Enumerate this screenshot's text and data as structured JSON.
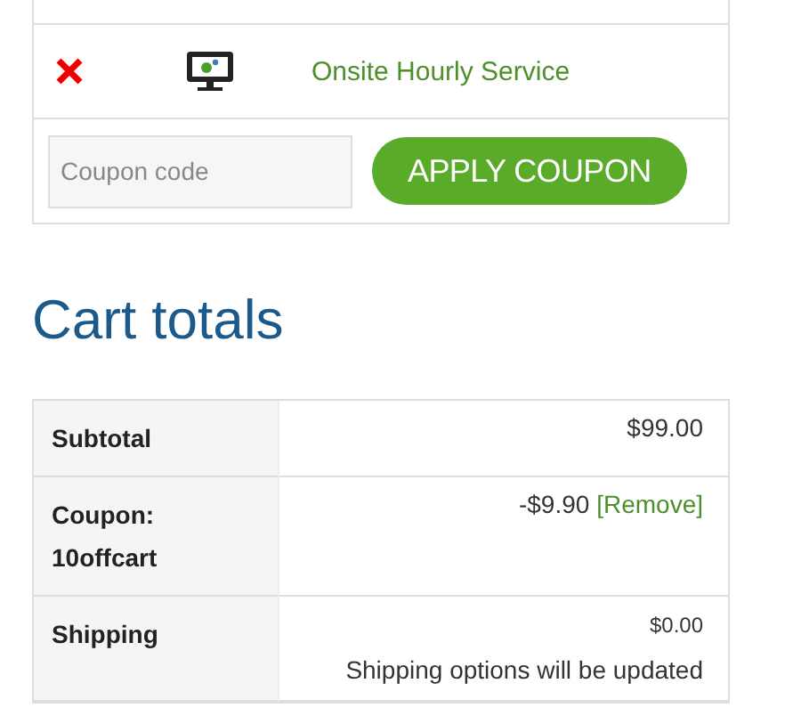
{
  "cart_item": {
    "product": "Onsite Hourly Service"
  },
  "coupon": {
    "placeholder": "Coupon code",
    "button": "APPLY COUPON"
  },
  "cart_totals": {
    "title": "Cart totals",
    "rows": [
      {
        "kind": "amount",
        "label": "Subtotal",
        "value": "$99.00"
      },
      {
        "kind": "coupon",
        "label": "Coupon: 10offcart",
        "value": "-$9.90",
        "link": "[Remove]"
      },
      {
        "kind": "shipping",
        "label": "Shipping",
        "value": "$0.00",
        "note": "Shipping options will be updated"
      }
    ]
  }
}
